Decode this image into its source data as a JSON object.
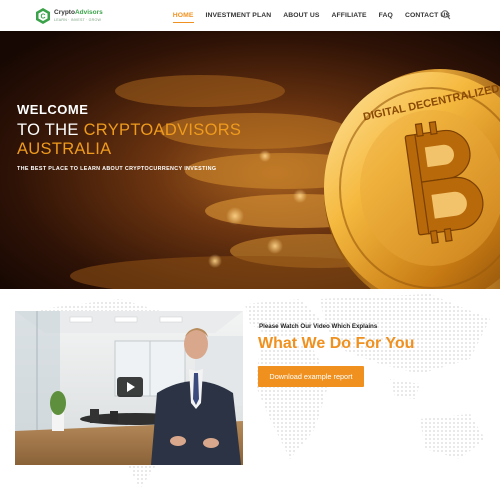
{
  "header": {
    "logo": {
      "name_part1": "Crypto",
      "name_part2": "Advisors",
      "tagline": "LEARN · INVEST · GROW"
    },
    "nav": [
      {
        "label": "HOME",
        "active": true
      },
      {
        "label": "INVESTMENT PLAN",
        "active": false
      },
      {
        "label": "ABOUT US",
        "active": false
      },
      {
        "label": "AFFILIATE",
        "active": false
      },
      {
        "label": "FAQ",
        "active": false
      },
      {
        "label": "CONTACT US",
        "active": false
      }
    ],
    "search_icon": "search-icon"
  },
  "hero": {
    "welcome": "WELCOME",
    "line2_prefix": "TO THE ",
    "line2_accent": "CRYPTOADVISORS",
    "line3": "AUSTRALIA",
    "tagline": "THE BEST PLACE TO LEARN ABOUT CRYPTOCURRENCY INVESTING",
    "coin_text": "DIGITAL DECENTRALIZED"
  },
  "video_section": {
    "caption": "Please Watch Our Video Which Explains",
    "title": "What We Do For You",
    "button_label": "Download example report",
    "play_icon": "play-icon"
  },
  "colors": {
    "accent": "#f0911f",
    "brand_green": "#3aa34a",
    "text_dark": "#333333"
  }
}
